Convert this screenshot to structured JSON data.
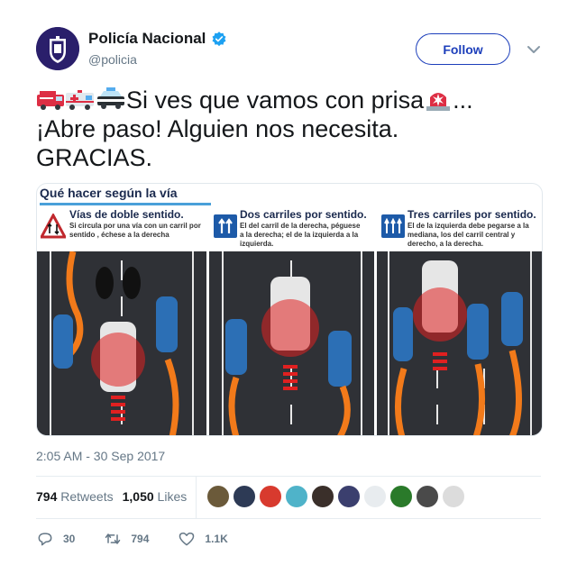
{
  "author": {
    "name": "Policía Nacional",
    "handle": "@policia",
    "verified": true
  },
  "follow_label": "Follow",
  "tweet": {
    "text_line1": "Si ves que vamos con prisa",
    "text_line1_suffix": "...",
    "text_line2": "¡Abre paso! Alguien nos necesita.",
    "text_line3": "GRACIAS.",
    "emojis": [
      "fire-engine",
      "ambulance",
      "police-car",
      "police-light"
    ]
  },
  "media": {
    "title": "Qué hacer según la vía",
    "panels": [
      {
        "title": "Vías de doble sentido.",
        "desc": "Si circula por una vía con un carril por sentido , échese a la derecha"
      },
      {
        "title": "Dos carriles por sentido.",
        "desc": "El del carril de la derecha, péguese a la derecha; el de la izquierda a la izquierda."
      },
      {
        "title": "Tres carriles por sentido.",
        "desc": "El de la izquierda debe pegarse a la mediana, los del carril central y derecho, a la derecha."
      }
    ]
  },
  "timestamp": "2:05 AM - 30 Sep 2017",
  "stats": {
    "retweets_count": "794",
    "retweets_label": "Retweets",
    "likes_count": "1,050",
    "likes_label": "Likes"
  },
  "liker_colors": [
    "#6b5a3a",
    "#2d3a55",
    "#d83a2e",
    "#4fb3c9",
    "#3a2f2a",
    "#3b3f6e",
    "#e8ecef",
    "#2a7a2a",
    "#4a4a4a",
    "#dcdcdc"
  ],
  "actions": {
    "replies": "30",
    "retweets": "794",
    "likes": "1.1K"
  },
  "colors": {
    "accent": "#1d3fbb",
    "verified": "#1da1f2",
    "muted": "#657786"
  }
}
